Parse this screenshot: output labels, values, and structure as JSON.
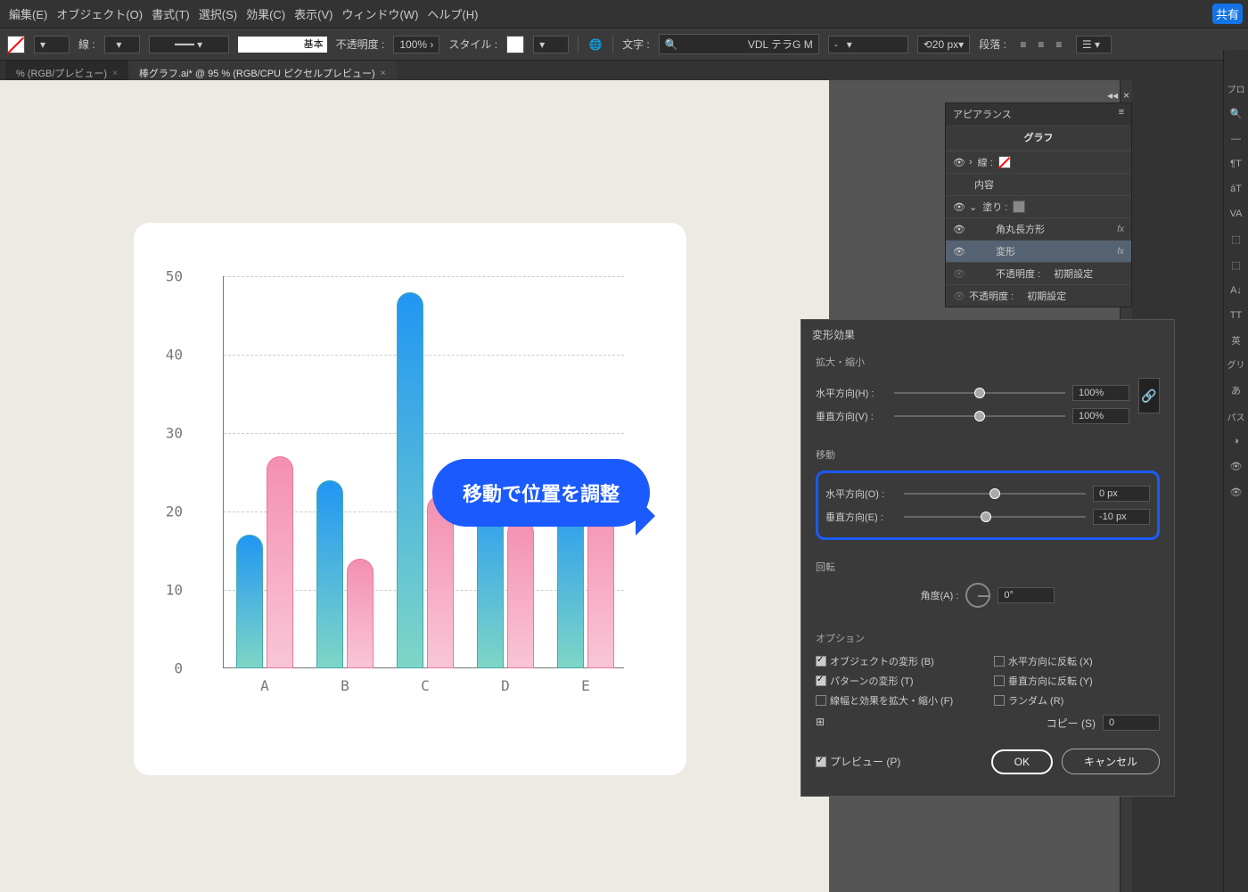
{
  "chart_data": {
    "type": "bar",
    "categories": [
      "A",
      "B",
      "C",
      "D",
      "E"
    ],
    "series": [
      {
        "name": "blue",
        "values": [
          17,
          24,
          48,
          24,
          23
        ]
      },
      {
        "name": "pink",
        "values": [
          27,
          14,
          22,
          19,
          22
        ]
      }
    ],
    "ylim": [
      0,
      50
    ],
    "yticks": [
      0,
      10,
      20,
      30,
      40,
      50
    ]
  },
  "menu": {
    "edit": "編集(E)",
    "object": "オブジェクト(O)",
    "format": "書式(T)",
    "select": "選択(S)",
    "effect": "効果(C)",
    "view": "表示(V)",
    "window": "ウィンドウ(W)",
    "help": "ヘルプ(H)",
    "share": "共有"
  },
  "toolbar": {
    "stroke_label": "線 :",
    "stroke_style": "基本",
    "opacity_label": "不透明度 :",
    "opacity_value": "100%",
    "style_label": "スタイル :",
    "text_label": "文字 :",
    "font_value": "VDL テラG M",
    "size_value": "20 px",
    "para_label": "段落 :"
  },
  "tabs": {
    "t1": "% (RGB/プレビュー)",
    "t2": "棒グラフ.ai* @ 95 % (RGB/CPU ピクセルプレビュー)"
  },
  "bubble": "移動で位置を調整",
  "appearance": {
    "title": "アピアランス",
    "graph": "グラフ",
    "stroke": "線 :",
    "content": "内容",
    "fill": "塗り :",
    "roundrect": "角丸長方形",
    "transform": "変形",
    "opacity1": "不透明度 :",
    "opacity1v": "初期設定",
    "opacity2": "不透明度 :",
    "opacity2v": "初期設定"
  },
  "dialog": {
    "title": "変形効果",
    "scale": "拡大・縮小",
    "hscale": "水平方向(H) :",
    "hscale_v": "100%",
    "vscale": "垂直方向(V) :",
    "vscale_v": "100%",
    "move": "移動",
    "hmove": "水平方向(O) :",
    "hmove_v": "0 px",
    "vmove": "垂直方向(E) :",
    "vmove_v": "-10 px",
    "rotate": "回転",
    "angle": "角度(A) :",
    "angle_v": "0°",
    "options": "オプション",
    "opt_obj": "オブジェクトの変形 (B)",
    "opt_reflx": "水平方向に反転 (X)",
    "opt_pat": "パターンの変形 (T)",
    "opt_refly": "垂直方向に反転 (Y)",
    "opt_stroke": "線幅と効果を拡大・縮小 (F)",
    "opt_random": "ランダム (R)",
    "copies": "コピー (S)",
    "copies_v": "0",
    "preview": "プレビュー (P)",
    "ok": "OK",
    "cancel": "キャンセル"
  },
  "rail": {
    "prop": "プロ",
    "eng": "英",
    "gly": "グリ",
    "pf": "パス"
  }
}
